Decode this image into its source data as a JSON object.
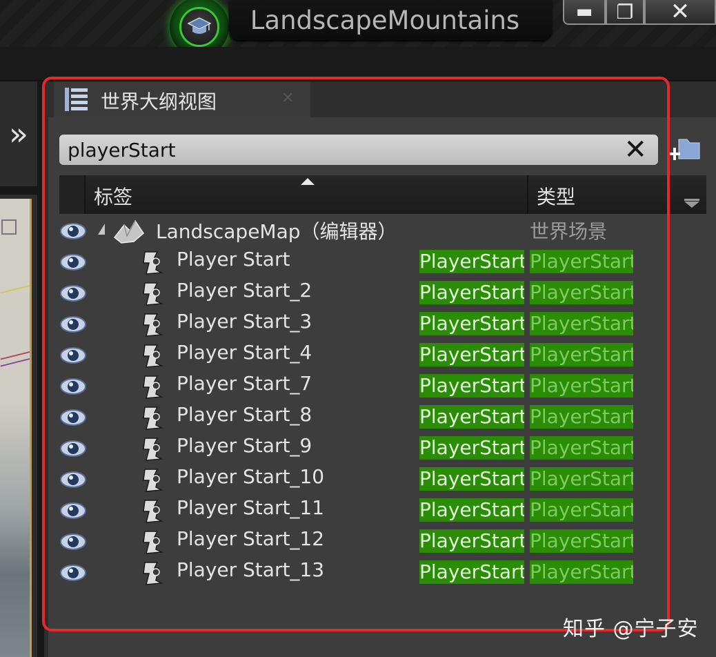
{
  "window": {
    "title": "LandscapeMountains",
    "minimize_glyph": "▬",
    "maximize_glyph": "❐",
    "close_glyph": "✕"
  },
  "panel": {
    "tab_title": "世界大纲视图",
    "tab_close": "✕",
    "search": {
      "value": "playerStart",
      "clear_glyph": "✕"
    },
    "columns": {
      "label": "标签",
      "type": "类型"
    },
    "map_row": {
      "name": "LandscapeMap（编辑器）",
      "type": "世界场景"
    },
    "items": [
      {
        "name": "Player Start",
        "tag": "PlayerStart",
        "type": "PlayerStart"
      },
      {
        "name": "Player Start_2",
        "tag": "PlayerStart",
        "type": "PlayerStart"
      },
      {
        "name": "Player Start_3",
        "tag": "PlayerStart",
        "type": "PlayerStart"
      },
      {
        "name": "Player Start_4",
        "tag": "PlayerStart",
        "type": "PlayerStart"
      },
      {
        "name": "Player Start_7",
        "tag": "PlayerStart",
        "type": "PlayerStart"
      },
      {
        "name": "Player Start_8",
        "tag": "PlayerStart",
        "type": "PlayerStart"
      },
      {
        "name": "Player Start_9",
        "tag": "PlayerStart",
        "type": "PlayerStart"
      },
      {
        "name": "Player Start_10",
        "tag": "PlayerStart",
        "type": "PlayerStart"
      },
      {
        "name": "Player Start_11",
        "tag": "PlayerStart",
        "type": "PlayerStart"
      },
      {
        "name": "Player Start_12",
        "tag": "PlayerStart",
        "type": "PlayerStart"
      },
      {
        "name": "Player Start_13",
        "tag": "PlayerStart",
        "type": "PlayerStart"
      }
    ]
  },
  "left": {
    "expand_glyph": "»"
  },
  "watermark": "知乎 @宁子安",
  "colors": {
    "highlight_border": "#e5282a",
    "tag_green": "#2b8c06",
    "app_icon_glow": "#1ea81e"
  }
}
